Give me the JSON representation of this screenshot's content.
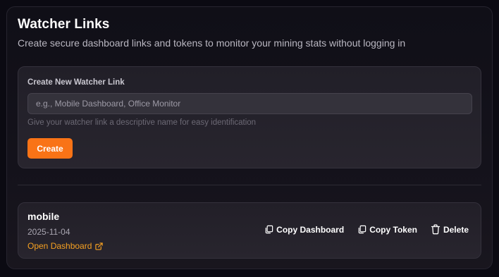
{
  "header": {
    "title": "Watcher Links",
    "subtitle": "Create secure dashboard links and tokens to monitor your mining stats without logging in"
  },
  "create_form": {
    "label": "Create New Watcher Link",
    "input_value": "",
    "input_placeholder": "e.g., Mobile Dashboard, Office Monitor",
    "hint": "Give your watcher link a descriptive name for easy identification",
    "button_label": "Create"
  },
  "links": [
    {
      "name": "mobile",
      "date": "2025-11-04",
      "open_label": "Open Dashboard",
      "copy_dashboard_label": "Copy Dashboard",
      "copy_token_label": "Copy Token",
      "delete_label": "Delete",
      "icons": {
        "open": "external-link-icon",
        "copy_dashboard": "copy-icon",
        "copy_token": "copy-icon",
        "delete": "trash-icon"
      }
    }
  ],
  "colors": {
    "accent": "#f97316",
    "link": "#f5a021",
    "background": "#0b0a12",
    "card": "#25222b"
  }
}
